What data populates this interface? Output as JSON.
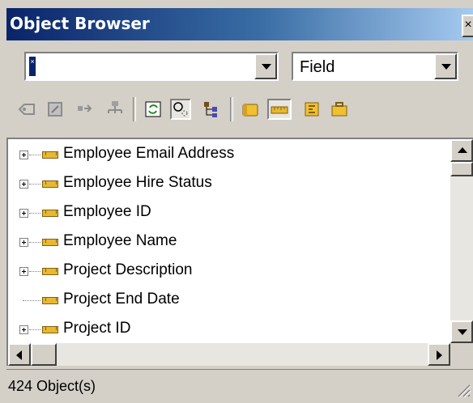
{
  "window": {
    "title": "Object Browser",
    "close_glyph": "×"
  },
  "filters": {
    "object_combo_value": "",
    "type_combo_value": "Field"
  },
  "toolbar": {
    "icons": [
      "tag-icon",
      "find-icon",
      "goto-icon",
      "hierarchy-icon",
      "refresh-icon",
      "search-objects-icon",
      "tree-icon",
      "table-icon",
      "field-icon",
      "document-icon",
      "briefcase-icon"
    ]
  },
  "tree": {
    "items": [
      {
        "label": "Employee Email Address",
        "expandable": true
      },
      {
        "label": "Employee Hire Status",
        "expandable": true
      },
      {
        "label": "Employee ID",
        "expandable": true
      },
      {
        "label": "Employee Name",
        "expandable": true
      },
      {
        "label": "Project Description",
        "expandable": true
      },
      {
        "label": "Project End Date",
        "expandable": false
      },
      {
        "label": "Project ID",
        "expandable": true
      }
    ]
  },
  "status": {
    "text": "424 Object(s)"
  },
  "colors": {
    "title_gradient_start": "#0a246a",
    "title_gradient_end": "#a6caf0",
    "field_icon": "#e8b830"
  }
}
